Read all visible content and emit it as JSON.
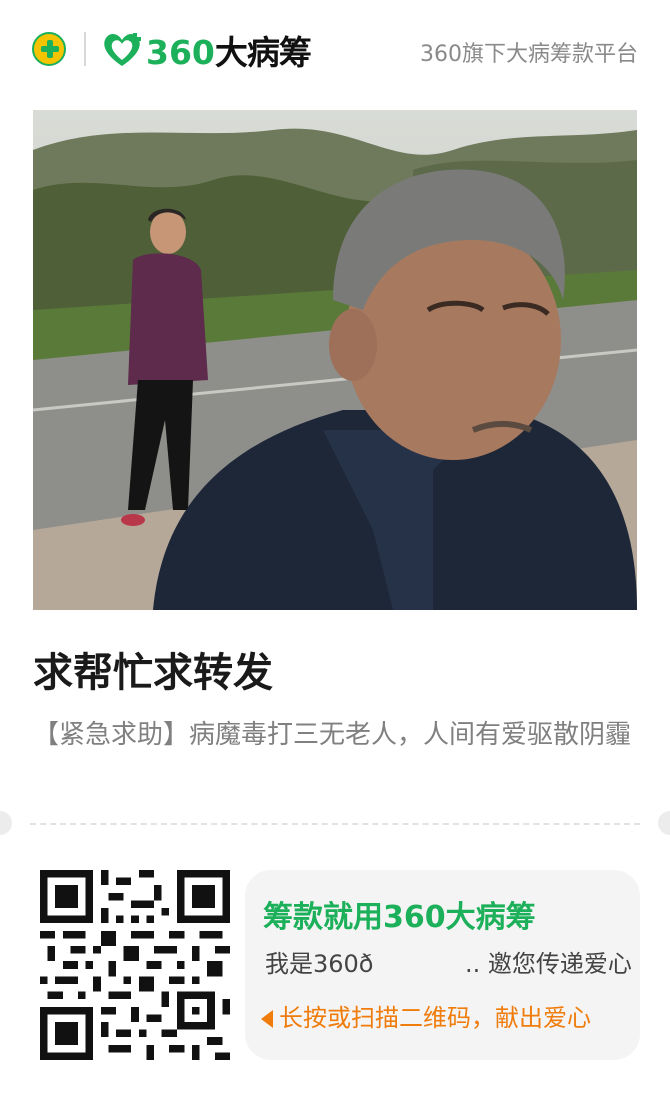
{
  "header": {
    "brand_prefix": "360",
    "brand_name": "大病筹",
    "slogan": "360旗下大病筹款平台"
  },
  "post": {
    "title": "求帮忙求转发",
    "description": "【紧急求助】病魔毒打三无老人，人间有爱驱散阴霾"
  },
  "card": {
    "title": "筹款就用360大病筹",
    "subtitle_left": "我是360ð",
    "subtitle_right": ".. 邀您传递爱心",
    "hint": "长按或扫描二维码，献出爱心"
  },
  "colors": {
    "brand_green": "#1cb05a",
    "logo_yellow": "#f5c400",
    "hint_orange": "#f07c0c"
  },
  "icons": [
    "app-logo-icon",
    "brand-heart-icon",
    "qr-code",
    "arrow-left-icon"
  ]
}
